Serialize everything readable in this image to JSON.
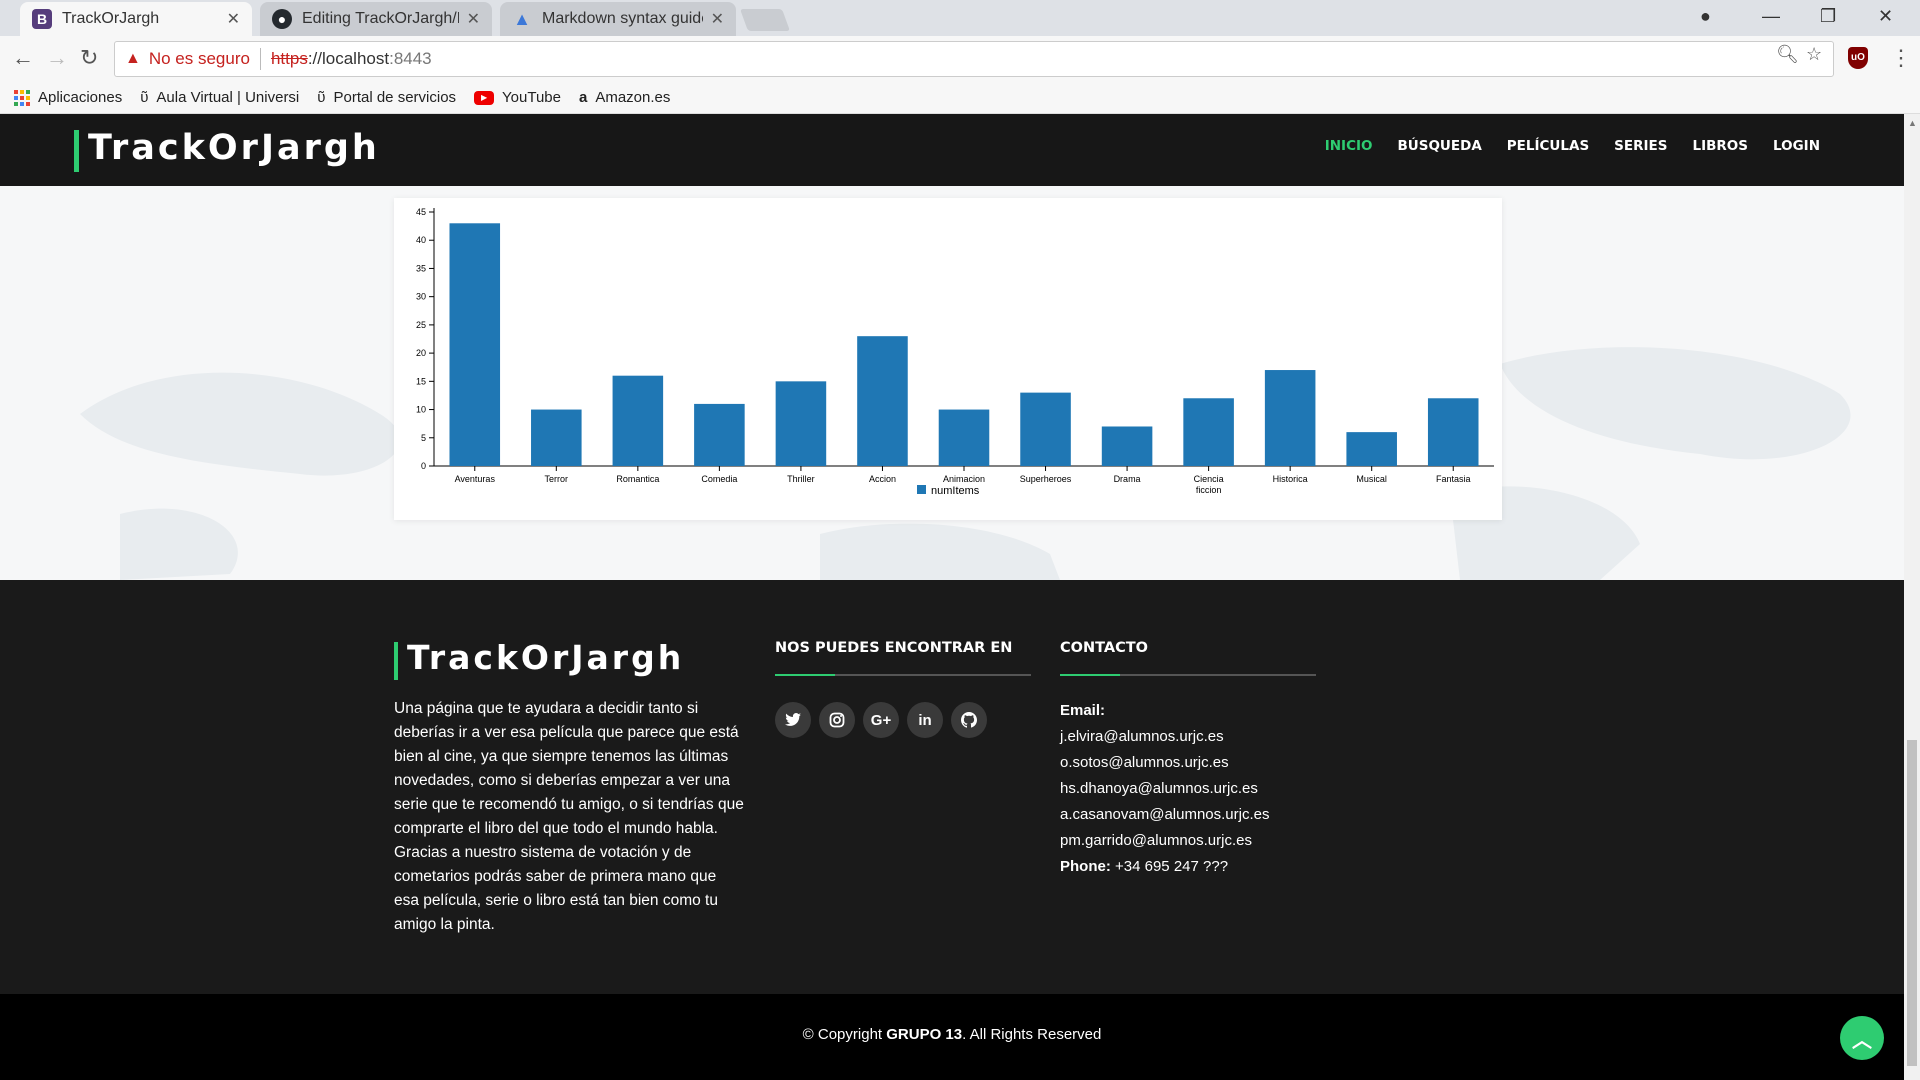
{
  "browser": {
    "tabs": [
      {
        "title": "TrackOrJargh",
        "favicon": "B",
        "active": true
      },
      {
        "title": "Editing TrackOrJargh/RE",
        "favicon": "github",
        "active": false
      },
      {
        "title": "Markdown syntax guide",
        "favicon": "triangle",
        "active": false
      }
    ],
    "address": {
      "security_label": "No es seguro",
      "scheme": "https",
      "host": "://localhost",
      "port": ":8443"
    },
    "bookmarks": [
      "Aplicaciones",
      "Aula Virtual | Universi",
      "Portal de servicios",
      "YouTube",
      "Amazon.es"
    ]
  },
  "site": {
    "logo": "TrackOrJargh",
    "nav": [
      "INICIO",
      "BÚSQUEDA",
      "PELÍCULAS",
      "SERIES",
      "LIBROS",
      "LOGIN"
    ],
    "accent_color": "#2ecc71"
  },
  "chart_data": {
    "type": "bar",
    "title": "",
    "categories": [
      "Aventuras",
      "Terror",
      "Romantica",
      "Comedia",
      "Thriller",
      "Accion",
      "Animacion",
      "Superheroes",
      "Drama",
      [
        "Ciencia",
        "ficcion"
      ],
      "Historica",
      "Musical",
      "Fantasia"
    ],
    "series": [
      {
        "name": "numItems",
        "values": [
          43,
          10,
          16,
          11,
          15,
          23,
          10,
          13,
          7,
          12,
          17,
          6,
          12
        ],
        "color": "#1f77b4"
      }
    ],
    "ylim": [
      0,
      45
    ],
    "yticks": [
      0,
      5,
      10,
      15,
      20,
      25,
      30,
      35,
      40,
      45
    ],
    "legend": "bottom-center"
  },
  "footer": {
    "logo": "TrackOrJargh",
    "about": "Una página que te ayudara a decidir tanto si deberías ir a ver esa película que parece que está bien al cine, ya que siempre tenemos las últimas novedades, como si deberías empezar a ver una serie que te recomendó tu amigo, o si tendrías que comprarte el libro del que todo el mundo habla. Gracias a nuestro sistema de votación y de cometarios podrás saber de primera mano que esa película, serie o libro está tan bien como tu amigo la pinta.",
    "social_heading": "NOS PUEDES ENCONTRAR EN",
    "socials": [
      "twitter-icon",
      "instagram-icon",
      "google-plus-icon",
      "linkedin-icon",
      "github-icon"
    ],
    "contact_heading": "CONTACTO",
    "email_label": "Email:",
    "emails": [
      "j.elvira@alumnos.urjc.es",
      "o.sotos@alumnos.urjc.es",
      "hs.dhanoya@alumnos.urjc.es",
      "a.casanovam@alumnos.urjc.es",
      "pm.garrido@alumnos.urjc.es"
    ],
    "phone_label": "Phone:",
    "phone": "+34 695 247 ???",
    "copyright_prefix": "© Copyright",
    "copyright_group": "GRUPO 13",
    "copyright_suffix": ". All Rights Reserved"
  }
}
